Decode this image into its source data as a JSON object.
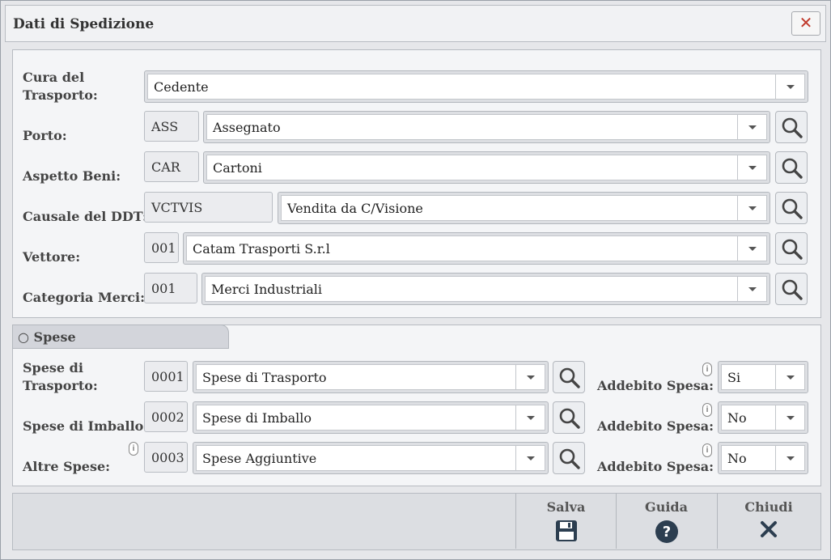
{
  "window": {
    "title": "Dati di Spedizione",
    "close_label": "✕"
  },
  "shipping": {
    "cura": {
      "label": "Cura del Trasporto:",
      "value": "Cedente"
    },
    "porto": {
      "label": "Porto:",
      "code": "ASS",
      "value": "Assegnato"
    },
    "aspetto": {
      "label": "Aspetto Beni:",
      "code": "CAR",
      "value": "Cartoni"
    },
    "causale": {
      "label": "Causale del DDT:",
      "code": "VCTVIS",
      "value": "Vendita da C/Visione"
    },
    "vettore": {
      "label": "Vettore:",
      "code": "001",
      "value": "Catam Trasporti S.r.l"
    },
    "categoria": {
      "label": "Categoria Merci:",
      "code": "001",
      "value": "Merci Industriali"
    }
  },
  "spese": {
    "section_title": "○ Spese",
    "rows": [
      {
        "label": "Spese di Trasporto:",
        "code": "0001",
        "value": "Spese di Trasporto",
        "addebito_label": "Addebito Spesa:",
        "addebito": "Si"
      },
      {
        "label": "Spese di Imballo:",
        "code": "0002",
        "value": "Spese di Imballo",
        "addebito_label": "Addebito Spesa:",
        "addebito": "No"
      },
      {
        "label": "Altre Spese:",
        "code": "0003",
        "value": "Spese Aggiuntive",
        "addebito_label": "Addebito Spesa:",
        "addebito": "No"
      }
    ],
    "info_glyph": "i"
  },
  "footer": {
    "save_label": "Salva",
    "help_label": "Guida",
    "close_label": "Chiudi"
  },
  "icons": {
    "search": "magnifier-icon",
    "save": "floppy-disk-icon",
    "help": "question-circle-icon",
    "close": "x-icon"
  }
}
